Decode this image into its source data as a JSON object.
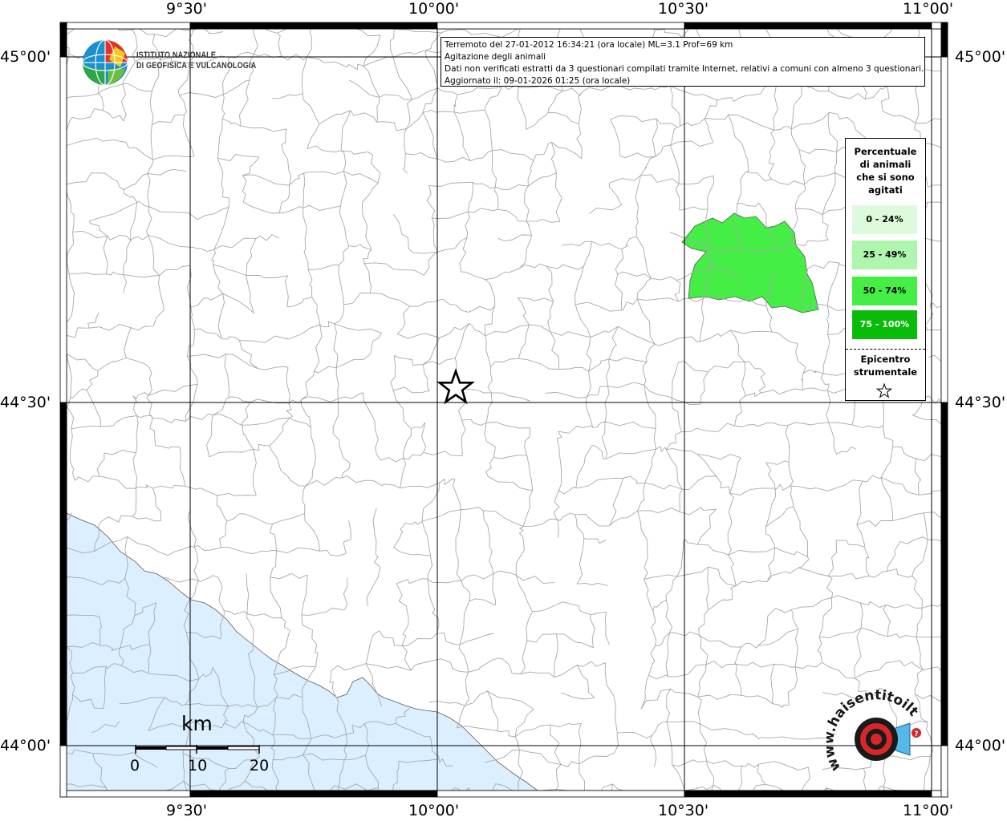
{
  "header": {
    "line1": "Terremoto del 27-01-2012 16:34:21 (ora locale) ML=3.1 Prof=69 km",
    "line2": "Agitazione degli animali",
    "line3": "Dati non verificati estratti da 3 questionari compilati tramite Internet, relativi a comuni con almeno 3 questionari.",
    "line4": "Aggiornato il: 09-01-2026 01:25 (ora locale)"
  },
  "logo": {
    "line1": "ISTITUTO NAZIONALE",
    "line2": "DI GEOFISICA E VULCANOLOGIA"
  },
  "axes": {
    "top": [
      "9°30'",
      "10°00'",
      "10°30'",
      "11°00'"
    ],
    "bottom": [
      "9°30'",
      "10°00'",
      "10°30'",
      "11°00'"
    ],
    "left": [
      "45°00'",
      "44°30'",
      "44°00'"
    ],
    "right": [
      "45°00'",
      "44°30'",
      "44°00'"
    ]
  },
  "legend": {
    "title_lines": [
      "Percentuale",
      "di animali",
      "che si sono",
      "agitati"
    ],
    "classes": [
      {
        "label": "0 - 24%",
        "color": "#ddfadd",
        "text_color": "#000000"
      },
      {
        "label": "25 - 49%",
        "color": "#aef5ae",
        "text_color": "#000000"
      },
      {
        "label": "50 - 74%",
        "color": "#45ee45",
        "text_color": "#000000"
      },
      {
        "label": "75 - 100%",
        "color": "#0abc0a",
        "text_color": "#ffffff"
      }
    ],
    "epicenter_lines": [
      "Epicentro",
      "strumentale"
    ],
    "epicenter_icon": "star-outline-icon"
  },
  "scale_bar": {
    "unit": "km",
    "labels": [
      "0",
      "10",
      "20"
    ]
  },
  "highlighted_area": {
    "class": "50 - 74%",
    "color": "#45ee45"
  },
  "colors": {
    "sea": "#dcefff",
    "boundary": "#a8a8a8",
    "frame": "#000000"
  },
  "watermark": {
    "text": "www.haisentitoilterremoto.it"
  }
}
